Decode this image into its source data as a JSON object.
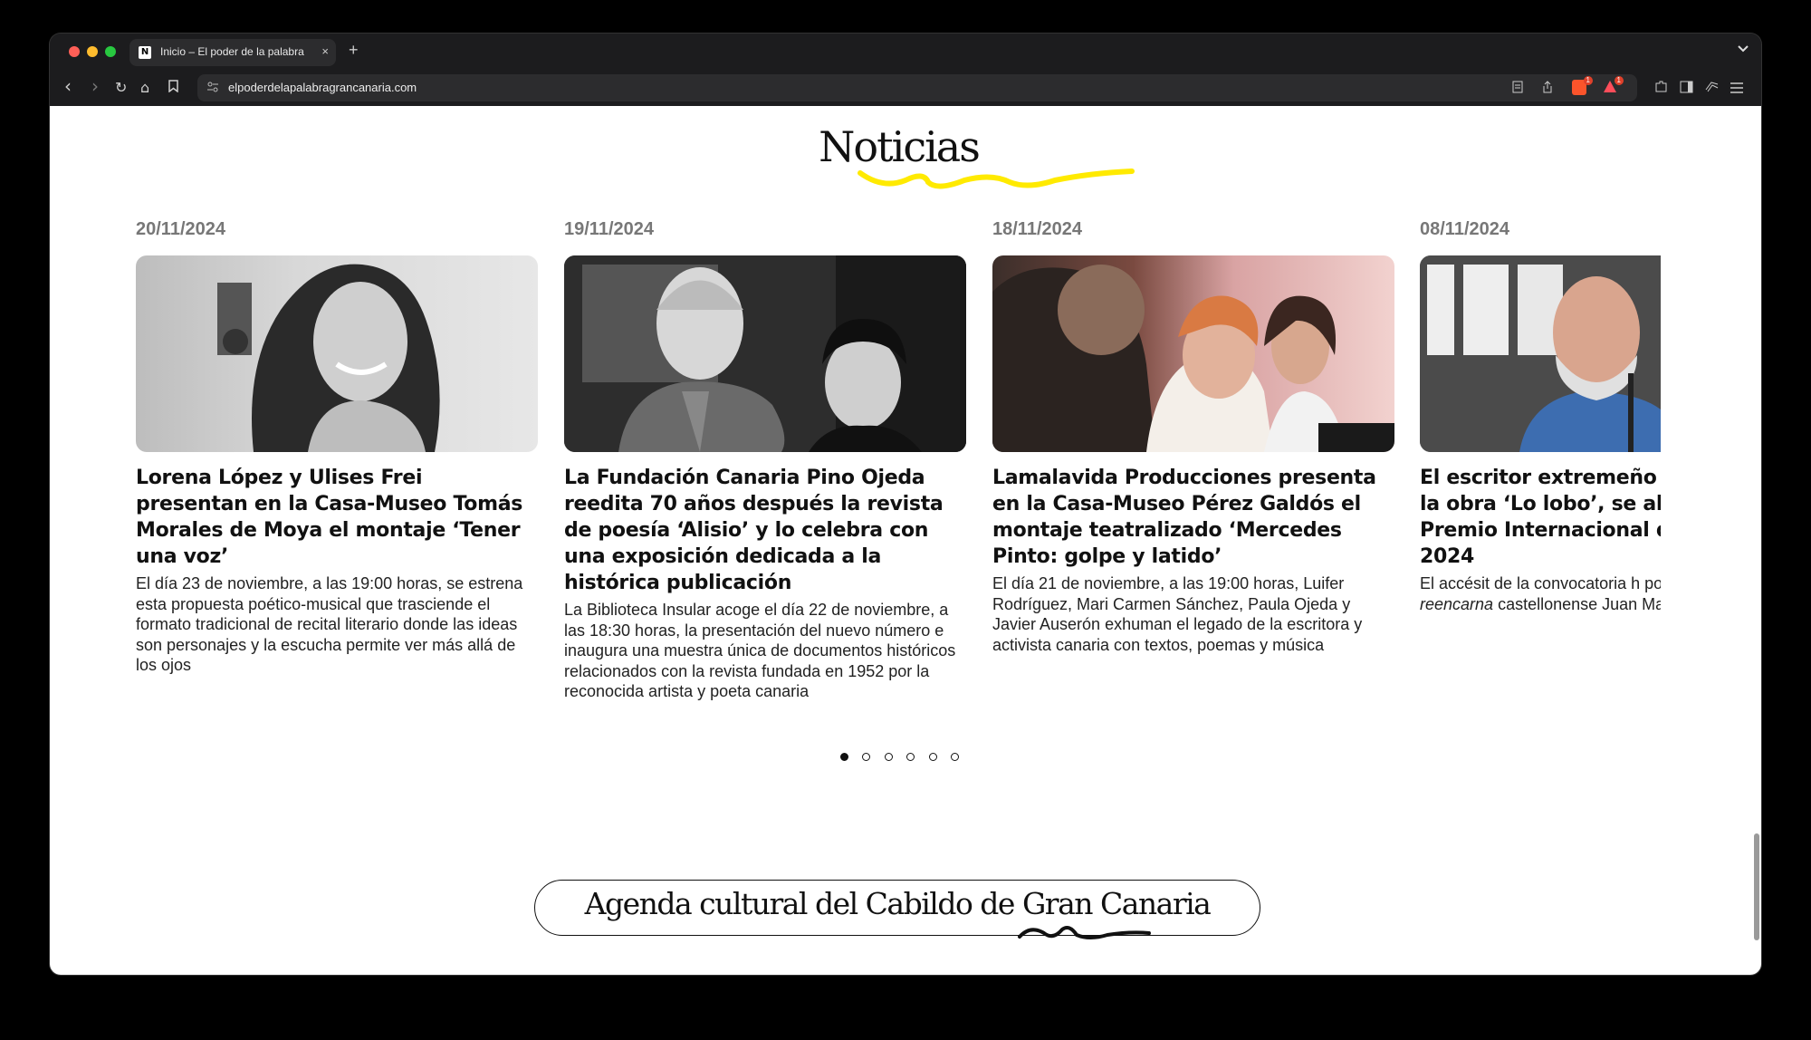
{
  "browser": {
    "tab_title": "Inicio – El poder de la palabra",
    "tab_close": "×",
    "new_tab": "+",
    "tab_menu": "⌄",
    "favicon_text": "N",
    "url": "elpoderdelapalabragrancanaria.com",
    "nav_back": "‹",
    "nav_forward": "›",
    "nav_reload": "↻",
    "nav_home": "⌂",
    "bookmark": "⚐",
    "brave_badge": "1",
    "alert_badge": "1"
  },
  "page": {
    "section_title": "Noticias",
    "highlight_color": "#ffea00",
    "agenda_title": "Agenda cultural del Cabildo de Gran Canaria"
  },
  "news": [
    {
      "date": "20/11/2024",
      "title": "Lorena López y Ulises Frei presentan en la Casa-Museo Tomás Morales de Moya el montaje ‘Tener una voz’",
      "text": "El día 23 de noviembre, a las 19:00 horas, se estrena esta propuesta poético-musical que trasciende el formato tradicional de recital literario donde las ideas son personajes y la escucha permite ver más allá de los ojos"
    },
    {
      "date": "19/11/2024",
      "title": "La Fundación Canaria Pino Ojeda reedita 70 años después la revista de poesía ‘Alisio’ y lo celebra con una exposición dedicada a la histórica publicación",
      "text": "La Biblioteca Insular acoge el día 22 de noviembre, a las 18:30 horas, la presentación del nuevo número e inaugura una muestra única de documentos históricos relacionados con la revista fundada en 1952 por la reconocida artista y poeta canaria"
    },
    {
      "date": "18/11/2024",
      "title": "Lamalavida Producciones presenta en la Casa-Museo Pérez Galdós el montaje teatralizado ‘Mercedes Pinto: golpe y latido’",
      "text": "El día 21 de noviembre, a las 19:00 horas, Luifer Rodríguez, Mari Carmen Sánchez, Paula Ojeda y Javier Auserón exhuman el legado de la escritora y activista canaria con textos, poemas y música"
    },
    {
      "date": "08/11/2024",
      "title": "El escritor extremeño J Ramírez, con la obra ‘Lo lobo’, se alza con la XXV Premio Internacional de Morales 2024",
      "text_before": "El accésit de la convocatoria h poemario ",
      "text_italic": "Desfile de reencarna",
      "text_after": " castellonense Juan Manuel Vel"
    }
  ],
  "carousel": {
    "dots": 6,
    "active": 0
  }
}
